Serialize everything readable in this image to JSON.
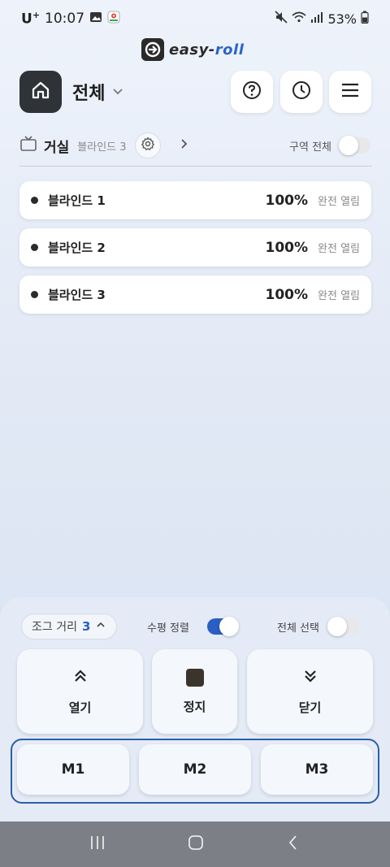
{
  "status_bar": {
    "carrier": "U",
    "carrier_sup": "+",
    "time": "10:07",
    "battery": "53%",
    "icons": [
      "gallery-icon",
      "maps-icon",
      "mute-icon",
      "wifi-icon",
      "signal-icon",
      "battery-icon"
    ]
  },
  "logo": {
    "word_main": "easy-",
    "word_accent": "roll"
  },
  "header": {
    "zone_title": "전체",
    "buttons": [
      "help-icon",
      "history-clock-icon",
      "menu-icon"
    ]
  },
  "room": {
    "name": "거실",
    "count_label": "블라인드 3",
    "zone_all_label": "구역 전체",
    "zone_all_on": false
  },
  "blinds": [
    {
      "name": "블라인드 1",
      "percent": "100%",
      "state": "완전 열림"
    },
    {
      "name": "블라인드 2",
      "percent": "100%",
      "state": "완전 열림"
    },
    {
      "name": "블라인드 3",
      "percent": "100%",
      "state": "완전 열림"
    }
  ],
  "controls": {
    "jog_label": "조그 거리",
    "jog_value": "3",
    "align_label": "수평 정렬",
    "align_on": true,
    "select_all_label": "전체 선택",
    "select_all_on": false,
    "open_label": "열기",
    "stop_label": "정지",
    "close_label": "닫기",
    "memory": [
      "M1",
      "M2",
      "M3"
    ]
  },
  "colors": {
    "accent": "#2a5ec4",
    "home_button": "#2f3237",
    "memory_frame": "#2f5ea8"
  }
}
